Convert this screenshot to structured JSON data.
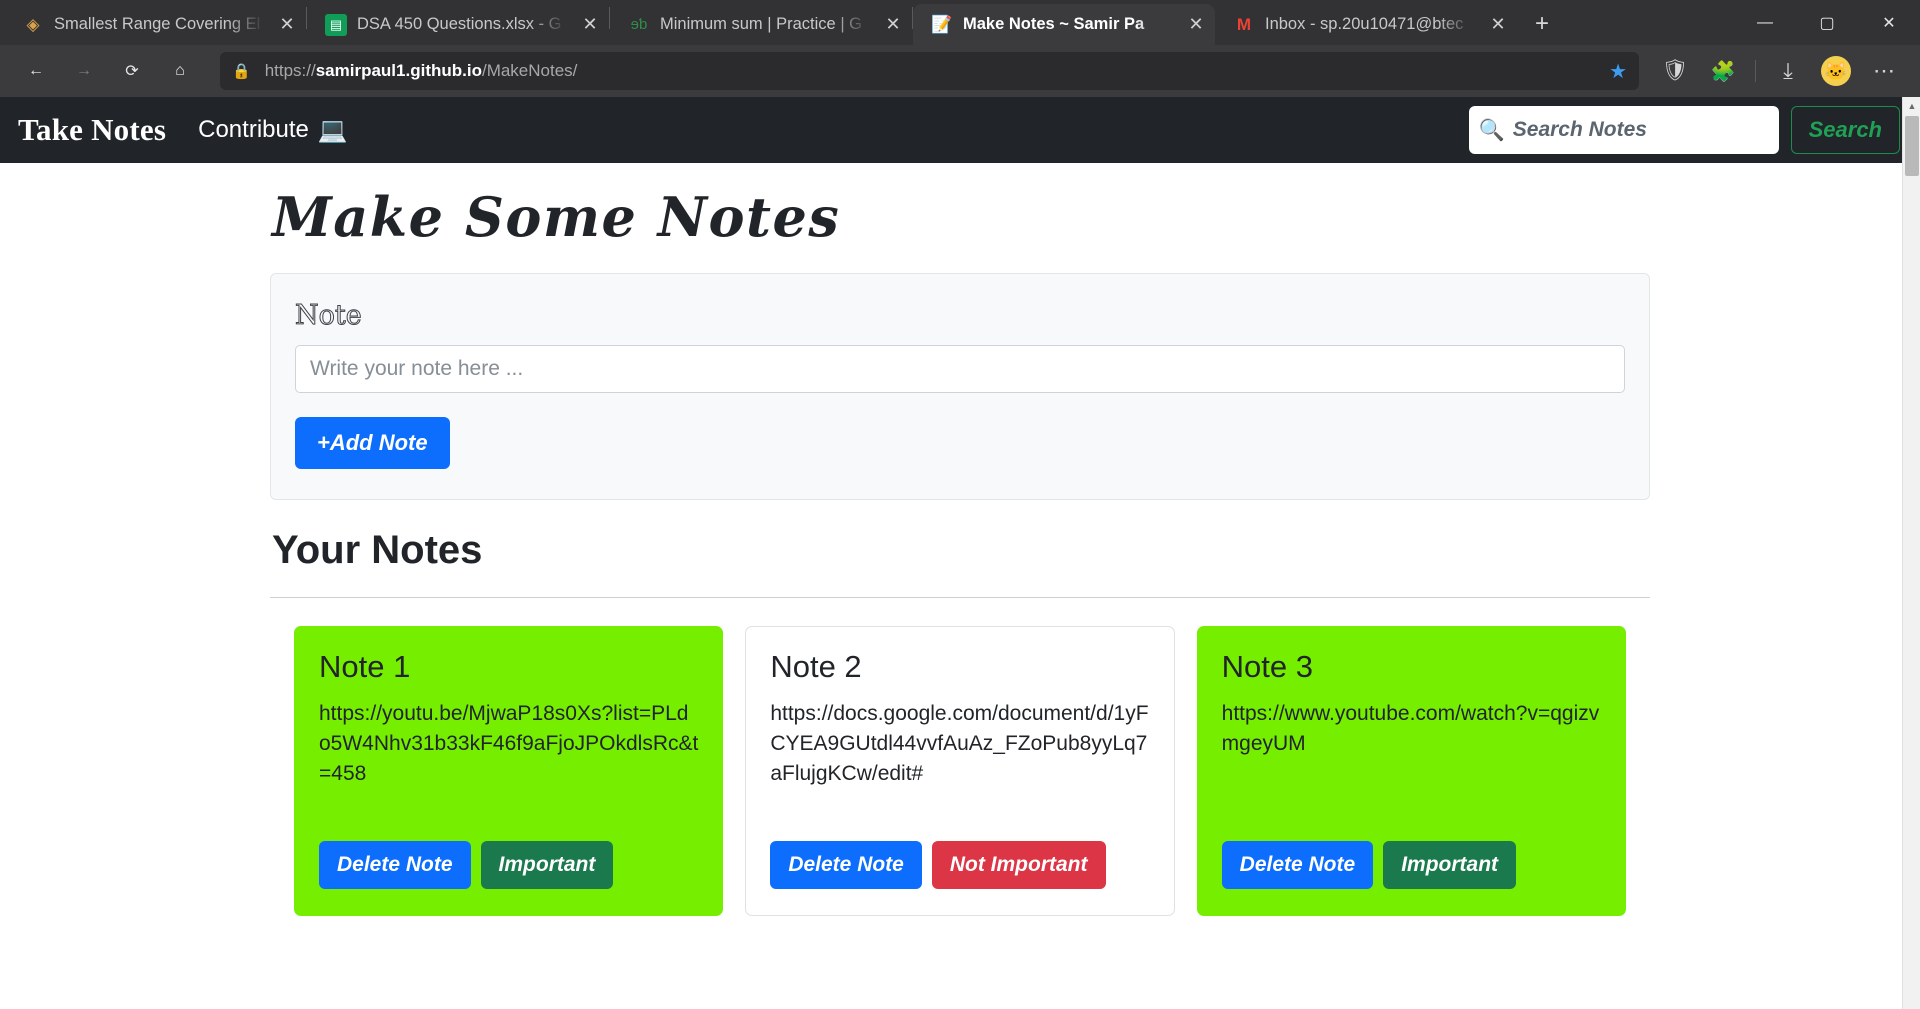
{
  "browser": {
    "tabs": [
      {
        "title": "Smallest Range Covering El",
        "favicon": "leetcode-icon",
        "glyph": "◈",
        "active": false
      },
      {
        "title": "DSA 450 Questions.xlsx - G",
        "favicon": "google-sheets-icon",
        "glyph": "▤",
        "active": false
      },
      {
        "title": "Minimum sum | Practice | G",
        "favicon": "geeksforgeeks-icon",
        "glyph": "ɘƅ",
        "active": false
      },
      {
        "title": "Make Notes ~ Samir Pa",
        "favicon": "notepad-icon",
        "glyph": "📝",
        "active": true
      },
      {
        "title": "Inbox - sp.20u10471@btec",
        "favicon": "gmail-icon",
        "glyph": "M",
        "active": false
      }
    ],
    "new_tab_label": "+",
    "window_controls": {
      "minimize": "—",
      "maximize": "▢",
      "close": "✕"
    },
    "nav": {
      "back": "←",
      "forward": "→",
      "reload": "⟳",
      "home": "⌂",
      "lock": "🔒",
      "url_scheme": "https://",
      "url_host": "samirpaul1.github.io",
      "url_path": "/MakeNotes/",
      "bookmark_star": "★"
    },
    "toolbar_icons": [
      {
        "name": "ublock-origin-icon",
        "glyph": "🛡"
      },
      {
        "name": "extensions-icon",
        "glyph": "🧩"
      },
      {
        "name": "downloads-icon",
        "glyph": "⤓"
      },
      {
        "name": "profile-avatar",
        "glyph": "🐱"
      },
      {
        "name": "browser-menu-icon",
        "glyph": "⋯"
      }
    ]
  },
  "site": {
    "navbar": {
      "brand": "Take Notes",
      "contribute_label": "Contribute",
      "contribute_icon": "💻"
    },
    "search": {
      "icon": "🔍",
      "placeholder": "Search Notes",
      "value": "",
      "button_label": "Search"
    },
    "heading": "Make Some Notes",
    "form": {
      "label": "Note",
      "placeholder": "Write your note here ...",
      "value": "",
      "add_button_label": "+Add Note"
    },
    "notes_section_title": "Your Notes",
    "notes": [
      {
        "title": "Note 1",
        "body": "https://youtu.be/MjwaP18s0Xs?list=PLdo5W4Nhv31b33kF46f9aFjoJPOkdlsRc&t=458",
        "important": true,
        "delete_label": "Delete Note",
        "toggle_label": "Important"
      },
      {
        "title": "Note 2",
        "body": "https://docs.google.com/document/d/1yFCYEA9GUtdl44vvfAuAz_FZoPub8yyLq7aFlujgKCw/edit#",
        "important": false,
        "delete_label": "Delete Note",
        "toggle_label": "Not Important"
      },
      {
        "title": "Note 3",
        "body": "https://www.youtube.com/watch?v=qgizvmgeyUM",
        "important": true,
        "delete_label": "Delete Note",
        "toggle_label": "Important"
      }
    ]
  },
  "colors": {
    "important_green": "#76ee00",
    "primary_blue": "#0d6efd",
    "danger_red": "#dc3545",
    "success_green": "#1b7a4d",
    "navbar_dark": "#212529",
    "search_green": "#1fa055"
  },
  "scrollbar": {
    "up": "▲",
    "down": "▼"
  }
}
